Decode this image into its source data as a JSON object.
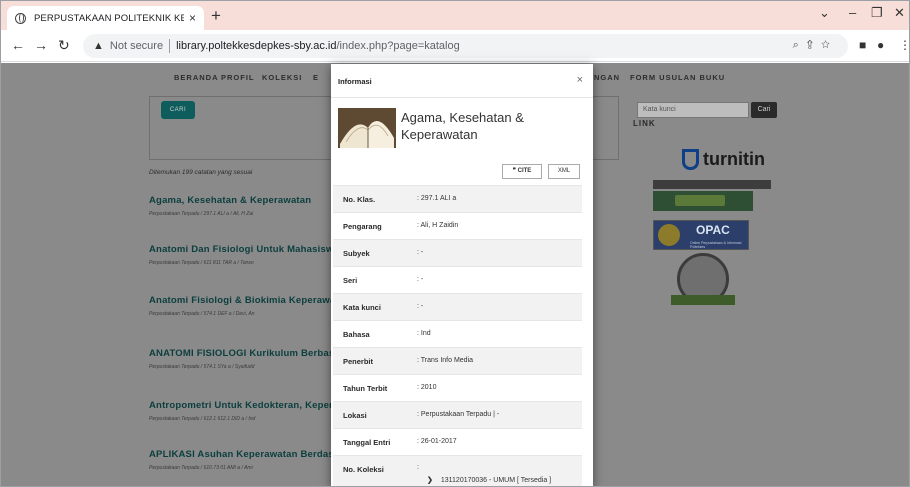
{
  "browser": {
    "tab_title": "PERPUSTAKAAN POLITEKNIK KES",
    "tab_close": "×",
    "new_tab": "+",
    "security_label": "Not secure",
    "url_host": "library.poltekkesdepkes-sby.ac.id",
    "url_path": "/index.php?page=katalog"
  },
  "nav": {
    "items": [
      "BERANDA",
      "PROFIL",
      "KOLEKSI",
      "E",
      "NGAN",
      "FORM USULAN BUKU"
    ]
  },
  "search": {
    "button_label": "CARI",
    "found_text": "Ditemukan 199 catatan yang sesuai"
  },
  "results": [
    {
      "title": "Agama, Kesehatan & Keperawatan",
      "meta": "Perpustakaan Terpadu  /  297.1 ALI a  /  Ali, H Zai"
    },
    {
      "title": "Anatomi Dan Fisiologi Untuk Mahasisw",
      "meta": "Perpustakaan Terpadu  /  611 811 TAR a  /  Tarwo"
    },
    {
      "title": "Anatomi Fisiologi & Biokimia Keperawa",
      "meta": "Perpustakaan Terpadu  /  574.1 DEF a  /  Devi, An"
    },
    {
      "title": "ANATOMI FISIOLOGI Kurikulum Berbas",
      "meta": "Perpustakaan Terpadu  /  574.1 SYa a  /  Syaifudd"
    },
    {
      "title": "Antropometri Untuk Kedokteran, Keper",
      "meta": "Perpustakaan Terpadu  /  612.1 612.1 DID a  /  Ind"
    },
    {
      "title": "APLIKASI Asuhan Keperawatan Berdas",
      "meta": "Perpustakaan Terpadu  /  610.73 01 AMI a  /  Ami"
    }
  ],
  "sidebar": {
    "search_placeholder": "Kata kunci",
    "search_button": "Cari",
    "link_heading": "LINK",
    "turnitin": "turnitin",
    "opac": "OPAC",
    "opac_sub": "Online Perpustakaan & Informasi Poltekkes",
    "fppti": "FPPTI"
  },
  "modal": {
    "header": "Informasi",
    "close": "×",
    "title": "Agama, Kesehatan & Keperawatan",
    "cite_label": "❞ CITE",
    "xml_label": "XML",
    "rows": [
      {
        "label": "No. Klas.",
        "value": ": 297.1 ALI a"
      },
      {
        "label": "Pengarang",
        "value": ": Ali, H Zaidin"
      },
      {
        "label": "Subyek",
        "value": ": -"
      },
      {
        "label": "Seri",
        "value": ": -"
      },
      {
        "label": "Kata kunci",
        "value": ": -"
      },
      {
        "label": "Bahasa",
        "value": ": Ind"
      },
      {
        "label": "Penerbit",
        "value": ": Trans Info Media"
      },
      {
        "label": "Tahun Terbit",
        "value": ": 2010"
      },
      {
        "label": "Lokasi",
        "value": ": Perpustakaan Terpadu | -"
      },
      {
        "label": "Tanggal Entri",
        "value": ": 26-01-2017"
      }
    ],
    "koleksi_label": "No. Koleksi",
    "koleksi_colon": ":",
    "koleksi_value": "131120170036 - UMUM  [ Tersedia ]"
  },
  "colors": {
    "tab_strip": "#f7ded9",
    "overlay": "#8a8a8a",
    "result_title": "#0b3e3e",
    "cari_button": "#0f5c5c"
  }
}
